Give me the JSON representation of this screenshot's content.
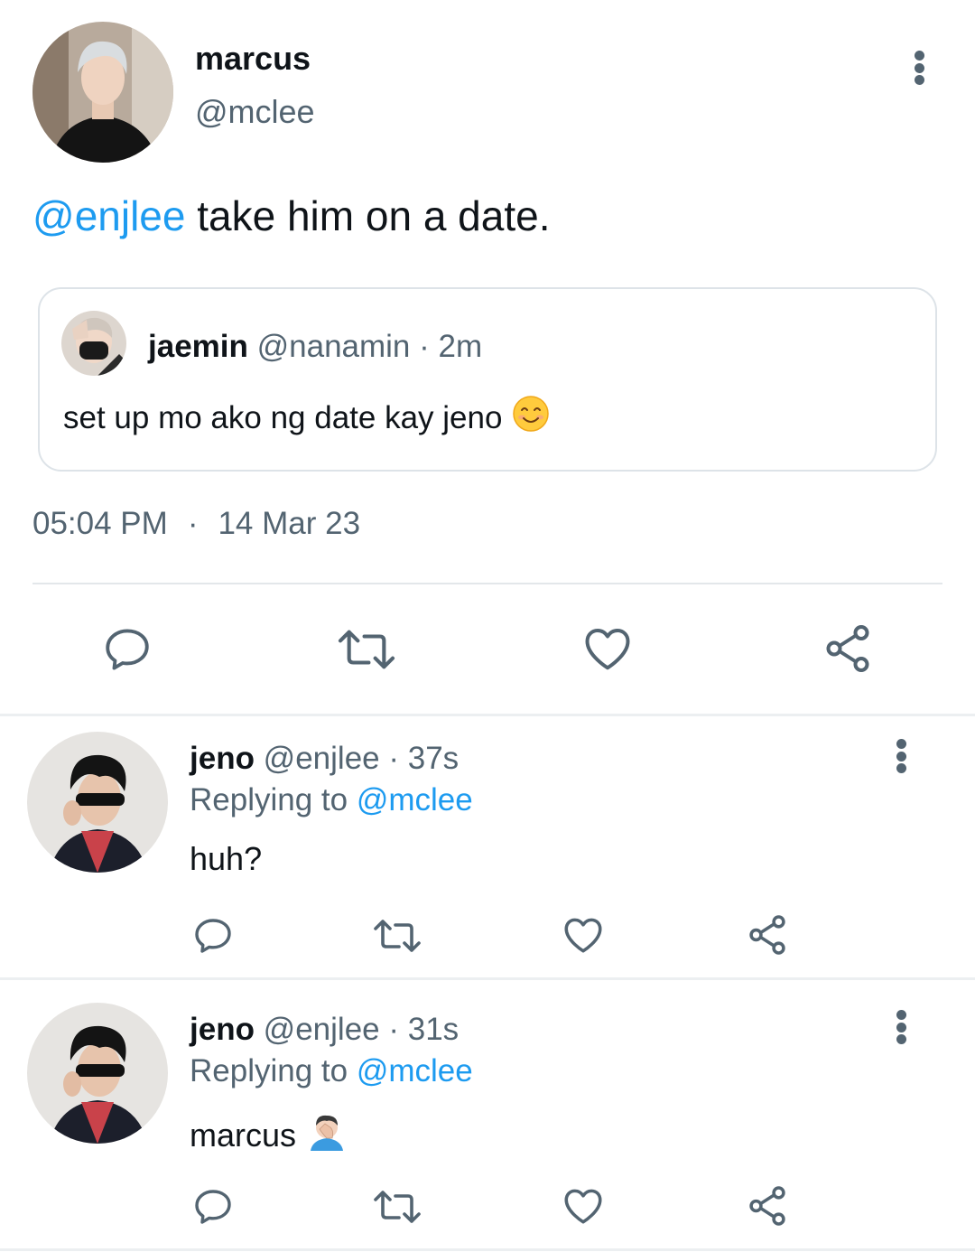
{
  "tweet": {
    "name": "marcus",
    "handle": "@mclee",
    "mention": "@enjlee",
    "text": " take him on a date.",
    "quote": {
      "name": "jaemin",
      "meta": " @nanamin · 2m",
      "text": "set up mo ako ng date kay jeno",
      "emoji": "smiling-face-emoji"
    },
    "time": "05:04 PM",
    "separator": "·",
    "date": "14 Mar 23"
  },
  "replies": [
    {
      "name": "jeno",
      "meta": " @enjlee · 37s",
      "replying_prefix": "Replying to ",
      "replying_handle": "@mclee",
      "text": "huh?",
      "emoji": ""
    },
    {
      "name": "jeno",
      "meta": " @enjlee · 31s",
      "replying_prefix": "Replying to ",
      "replying_handle": "@mclee",
      "text": "marcus",
      "emoji": "facepalm-emoji"
    }
  ],
  "icons": {
    "reply": "reply-icon",
    "retweet": "retweet-icon",
    "like": "heart-icon",
    "share": "share-icon",
    "more": "more-vertical-icon"
  },
  "colors": {
    "accent": "#1d9bf0",
    "secondary_text": "#536471",
    "divider": "#e3e7ea"
  }
}
